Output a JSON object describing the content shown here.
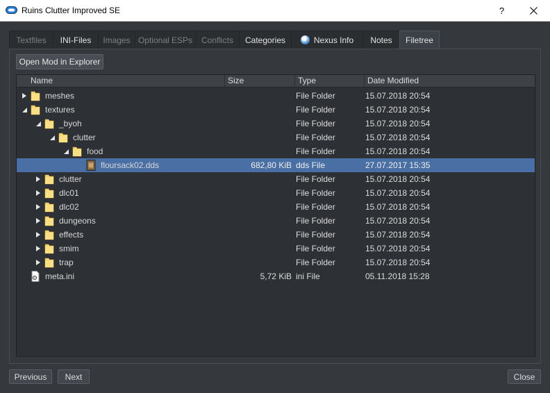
{
  "window": {
    "title": "Ruins Clutter Improved SE",
    "help": "?",
    "close": "✕"
  },
  "tabs": [
    {
      "label": "Textfiles",
      "state": "disabled"
    },
    {
      "label": "INI-Files",
      "state": "enabled"
    },
    {
      "label": "Images",
      "state": "disabled"
    },
    {
      "label": "Optional ESPs",
      "state": "disabled"
    },
    {
      "label": "Conflicts",
      "state": "disabled"
    },
    {
      "label": "Categories",
      "state": "enabled"
    },
    {
      "label": "Nexus Info",
      "state": "enabled",
      "icon": "globe-icon"
    },
    {
      "label": "Notes",
      "state": "enabled"
    },
    {
      "label": "Filetree",
      "state": "active"
    }
  ],
  "open_button": "Open Mod in Explorer",
  "columns": {
    "name": "Name",
    "size": "Size",
    "type": "Type",
    "date": "Date Modified"
  },
  "rows": [
    {
      "name": "meshes",
      "size": "",
      "type": "File Folder",
      "date": "15.07.2018 20:54",
      "depth": 0,
      "arrow": "collapsed",
      "icon": "folder"
    },
    {
      "name": "textures",
      "size": "",
      "type": "File Folder",
      "date": "15.07.2018 20:54",
      "depth": 0,
      "arrow": "expanded",
      "icon": "folder"
    },
    {
      "name": "_byoh",
      "size": "",
      "type": "File Folder",
      "date": "15.07.2018 20:54",
      "depth": 1,
      "arrow": "expanded",
      "icon": "folder"
    },
    {
      "name": "clutter",
      "size": "",
      "type": "File Folder",
      "date": "15.07.2018 20:54",
      "depth": 2,
      "arrow": "expanded",
      "icon": "folder"
    },
    {
      "name": "food",
      "size": "",
      "type": "File Folder",
      "date": "15.07.2018 20:54",
      "depth": 3,
      "arrow": "expanded",
      "icon": "folder"
    },
    {
      "name": "floursack02.dds",
      "size": "682,80 KiB",
      "type": "dds File",
      "date": "27.07.2017 15:35",
      "depth": 4,
      "arrow": "none",
      "icon": "image",
      "selected": true
    },
    {
      "name": "clutter",
      "size": "",
      "type": "File Folder",
      "date": "15.07.2018 20:54",
      "depth": 1,
      "arrow": "collapsed",
      "icon": "folder"
    },
    {
      "name": "dlc01",
      "size": "",
      "type": "File Folder",
      "date": "15.07.2018 20:54",
      "depth": 1,
      "arrow": "collapsed",
      "icon": "folder"
    },
    {
      "name": "dlc02",
      "size": "",
      "type": "File Folder",
      "date": "15.07.2018 20:54",
      "depth": 1,
      "arrow": "collapsed",
      "icon": "folder"
    },
    {
      "name": "dungeons",
      "size": "",
      "type": "File Folder",
      "date": "15.07.2018 20:54",
      "depth": 1,
      "arrow": "collapsed",
      "icon": "folder"
    },
    {
      "name": "effects",
      "size": "",
      "type": "File Folder",
      "date": "15.07.2018 20:54",
      "depth": 1,
      "arrow": "collapsed",
      "icon": "folder"
    },
    {
      "name": "smim",
      "size": "",
      "type": "File Folder",
      "date": "15.07.2018 20:54",
      "depth": 1,
      "arrow": "collapsed",
      "icon": "folder"
    },
    {
      "name": "trap",
      "size": "",
      "type": "File Folder",
      "date": "15.07.2018 20:54",
      "depth": 1,
      "arrow": "collapsed",
      "icon": "folder"
    },
    {
      "name": "meta.ini",
      "size": "5,72 KiB",
      "type": "ini File",
      "date": "05.11.2018 15:28",
      "depth": 0,
      "arrow": "none",
      "icon": "ini"
    }
  ],
  "buttons": {
    "previous": "Previous",
    "next": "Next",
    "close": "Close"
  },
  "colors": {
    "accent_selected": "#4a6fa5",
    "background": "#35383c",
    "folder": "#f5d56e"
  }
}
